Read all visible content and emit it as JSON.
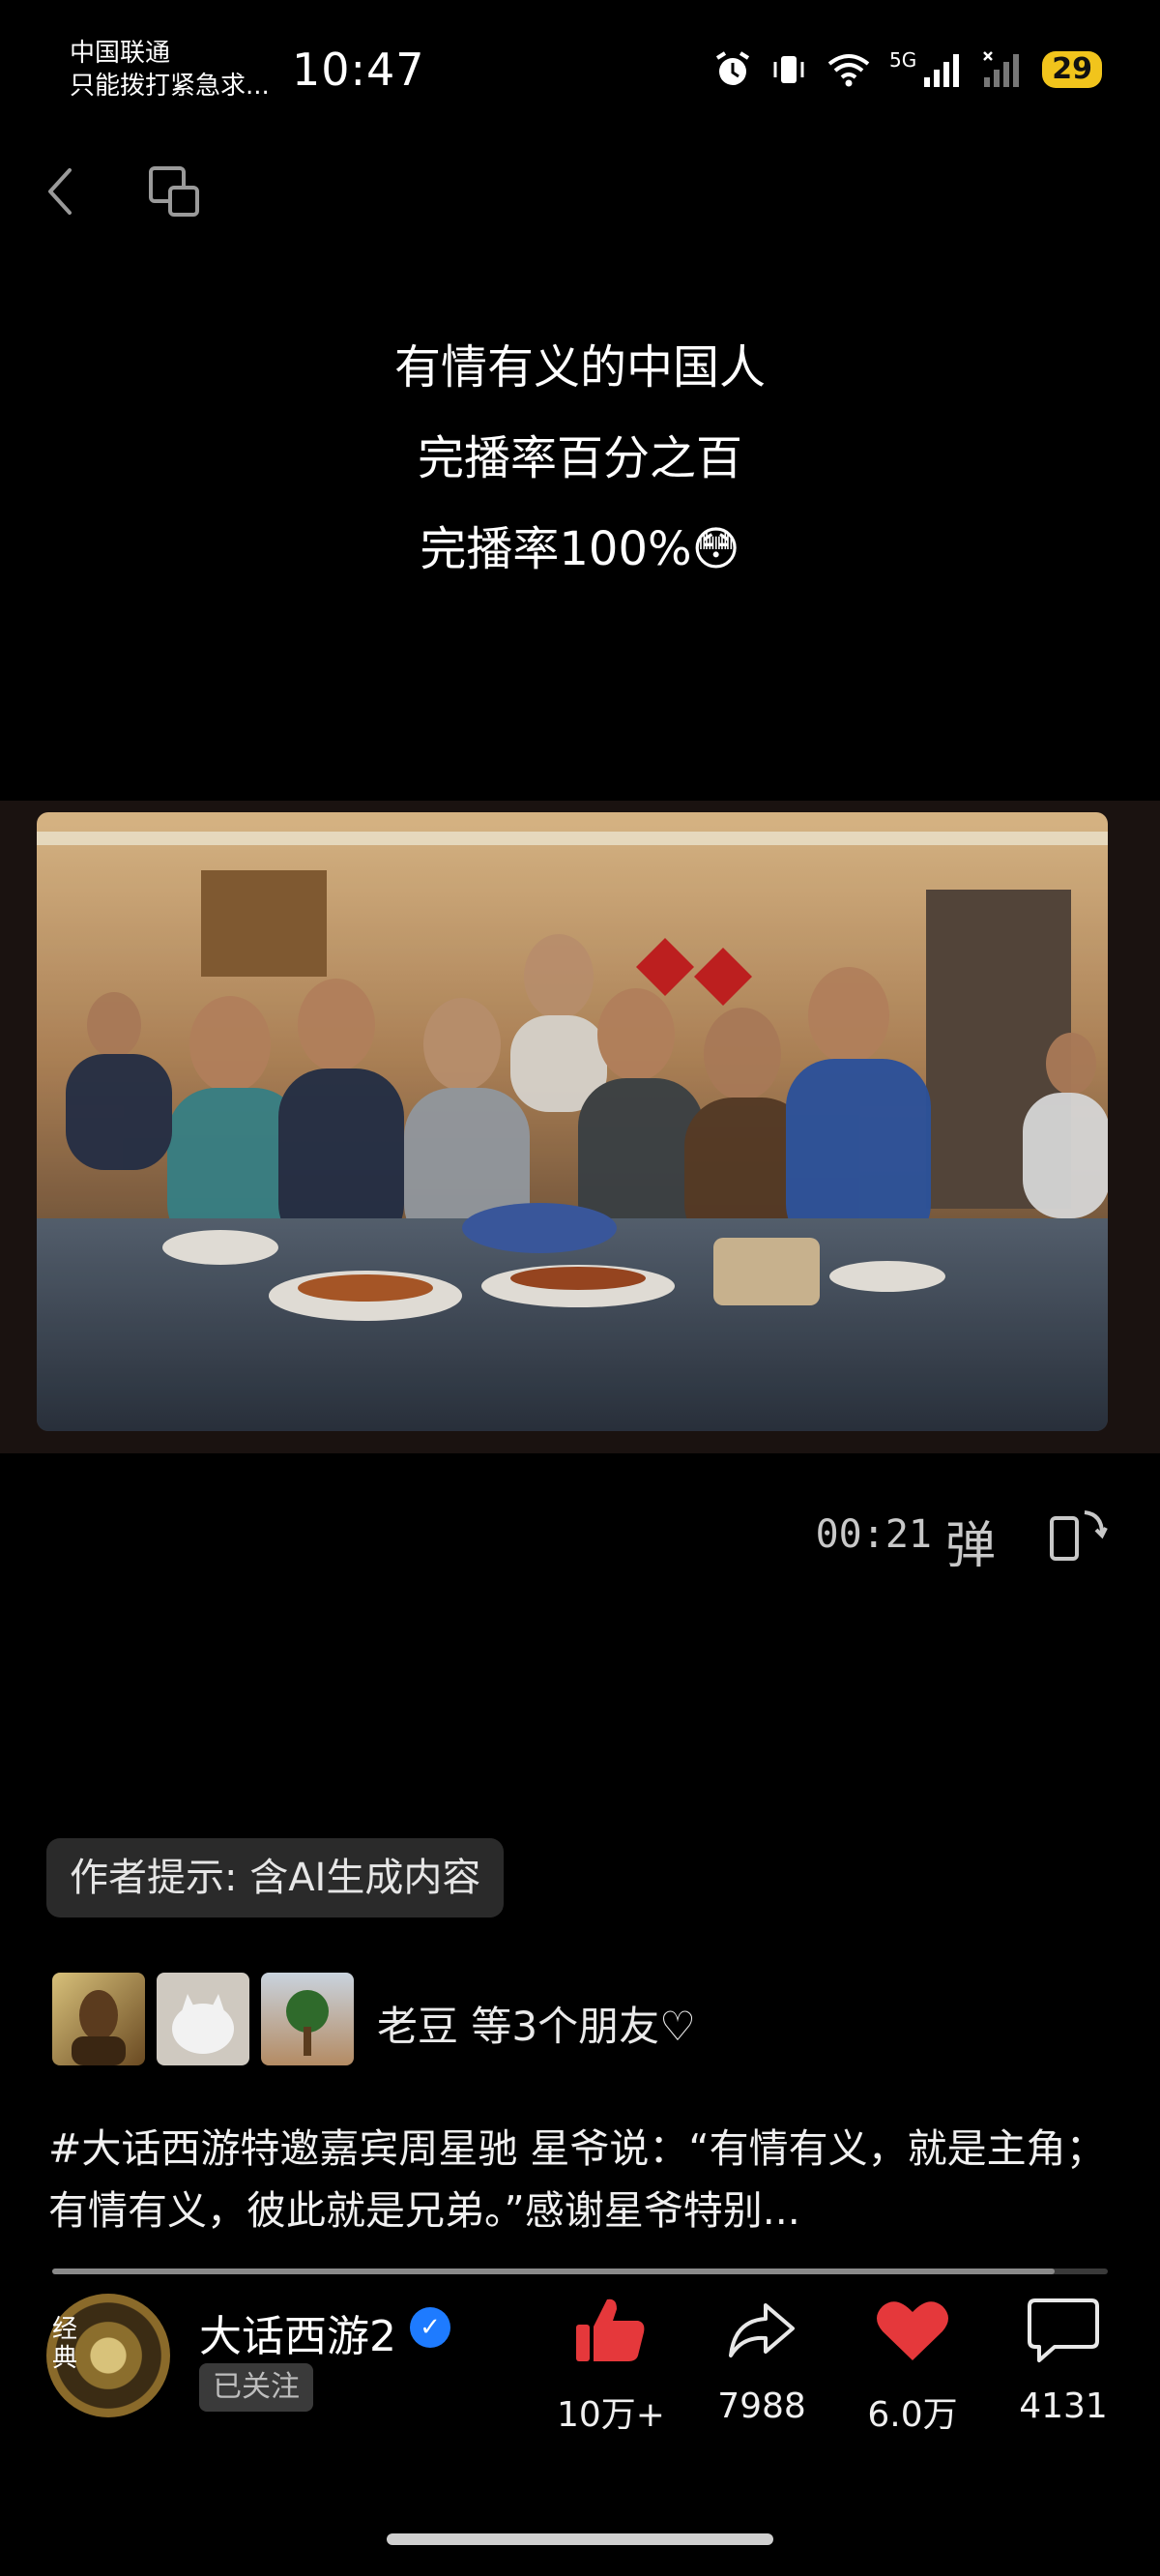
{
  "status_bar": {
    "carrier": "中国联通",
    "emergency": "只能拨打紧急求...",
    "time": "10:47",
    "network": "5G",
    "battery": "29"
  },
  "overlay": {
    "lines": [
      "有情有义的中国人",
      "完播率百分之百",
      "完播率100%😳"
    ]
  },
  "video": {
    "elapsed": "00:21",
    "danmu_label": "弹",
    "progress": 0.95
  },
  "ai_tip": "作者提示: 含AI生成内容",
  "friends": {
    "text": "老豆 等3个朋友♡"
  },
  "description": "#大话西游特邀嘉宾周星驰  星爷说：“有情有义，就是主角；有情有义，彼此就是兄弟。”感谢星爷特别...",
  "author": {
    "name": "大话西游2",
    "avatar_text": "经典",
    "follow_status": "已关注"
  },
  "actions": {
    "like": "10万+",
    "share": "7988",
    "favorite": "6.0万",
    "comment": "4131"
  },
  "colors": {
    "like": "#e5383b",
    "favorite": "#e5383b",
    "verify": "#1e7bff",
    "battery": "#f1c41c"
  }
}
